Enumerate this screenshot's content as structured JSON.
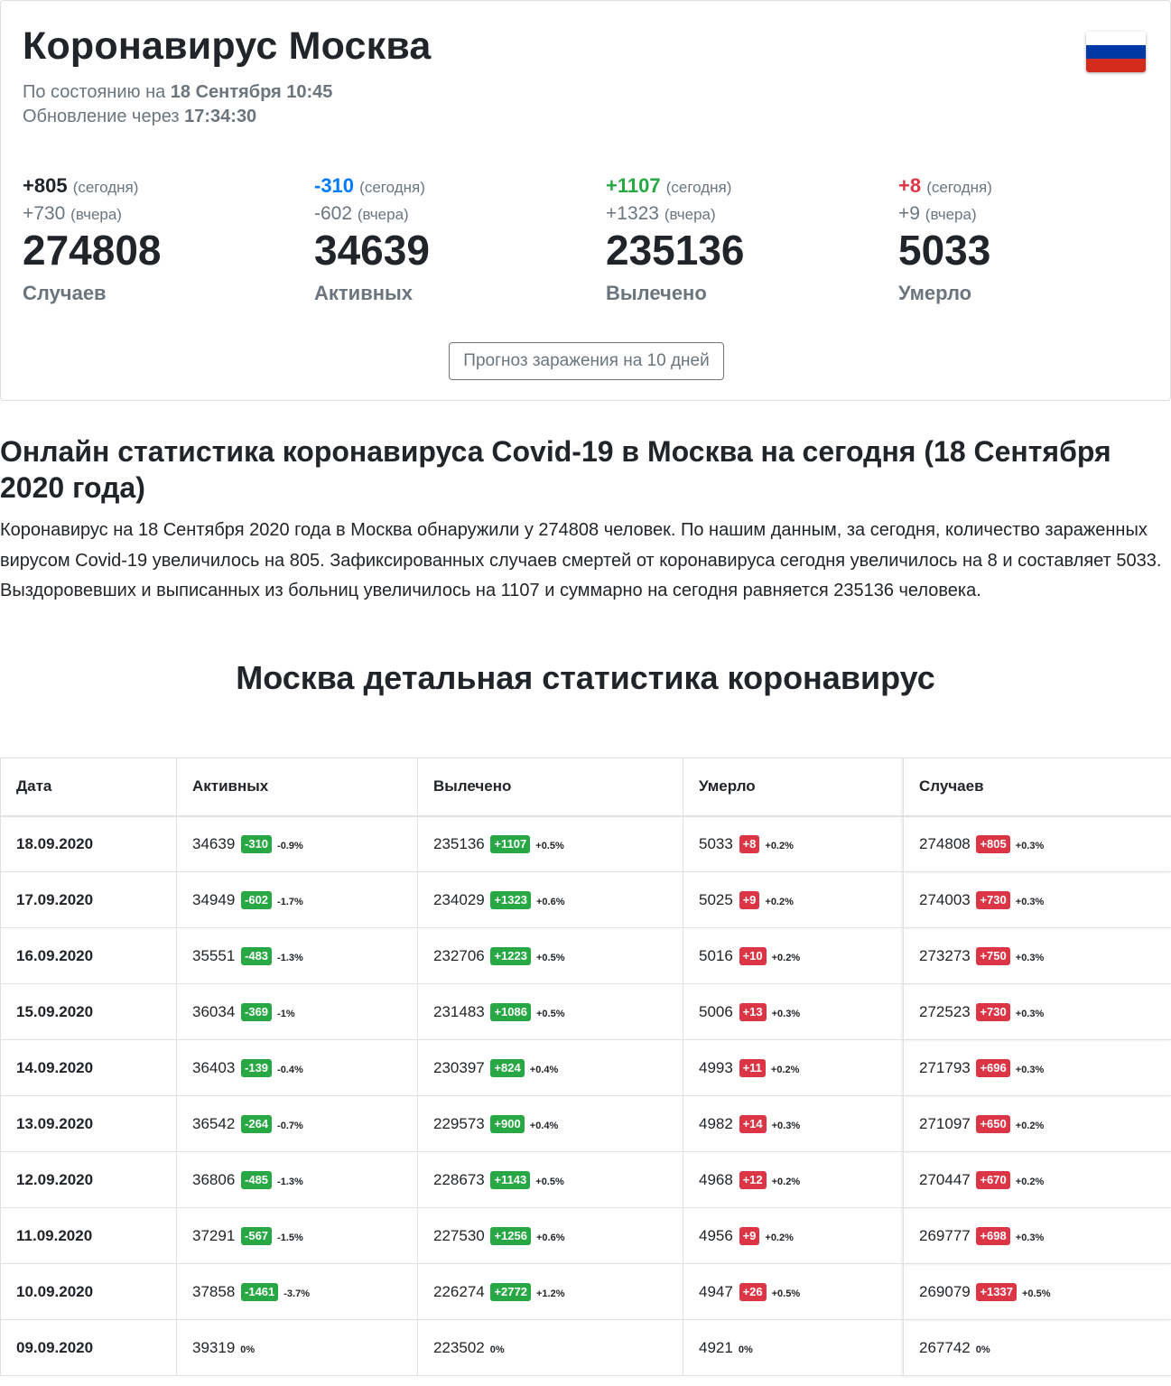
{
  "header": {
    "title": "Коронавирус Москва",
    "status_prefix": "По состоянию на",
    "status_date": "18 Сентября 10:45",
    "update_prefix": "Обновление через",
    "update_time": "17:34:30",
    "flag_icon": "russia-flag-icon",
    "flag_colors": [
      "#ffffff",
      "#0039a6",
      "#d52b1e"
    ]
  },
  "stats": [
    {
      "today": "+805",
      "today_label": "(сегодня)",
      "yesterday": "+730",
      "yesterday_label": "(вчера)",
      "total": "274808",
      "label": "Случаев",
      "today_color": "#212529"
    },
    {
      "today": "-310",
      "today_label": "(сегодня)",
      "yesterday": "-602",
      "yesterday_label": "(вчера)",
      "total": "34639",
      "label": "Активных",
      "today_color": "#007bff"
    },
    {
      "today": "+1107",
      "today_label": "(сегодня)",
      "yesterday": "+1323",
      "yesterday_label": "(вчера)",
      "total": "235136",
      "label": "Вылечено",
      "today_color": "#28a745"
    },
    {
      "today": "+8",
      "today_label": "(сегодня)",
      "yesterday": "+9",
      "yesterday_label": "(вчера)",
      "total": "5033",
      "label": "Умерло",
      "today_color": "#dc3545"
    }
  ],
  "forecast_button": "Прогноз заражения на 10 дней",
  "article": {
    "heading": "Онлайн статистика коронавируса Covid-19 в Москва на сегодня (18 Сентября 2020 года)",
    "text": "Коронавирус на 18 Сентября 2020 года в Москва обнаружили у 274808 человек. По нашим данным, за сегодня, количество зараженных вирусом Covid-19 увеличилось на 805. Зафиксированных случаев смертей от коронавируса сегодня увеличилось на 8 и составляет 5033. Выздоровевших и выписанных из больниц увеличилось на 1107 и суммарно на сегодня равняется 235136 человека."
  },
  "table_title": "Москва детальная статистика коронавирус",
  "table": {
    "headers": [
      "Дата",
      "Активных",
      "Вылечено",
      "Умерло",
      "Случаев"
    ],
    "rows": [
      {
        "date": "18.09.2020",
        "active": "34639",
        "active_d": "-310",
        "active_p": "-0.9%",
        "recov": "235136",
        "recov_d": "+1107",
        "recov_p": "+0.5%",
        "dead": "5033",
        "dead_d": "+8",
        "dead_p": "+0.2%",
        "cases": "274808",
        "cases_d": "+805",
        "cases_p": "+0.3%"
      },
      {
        "date": "17.09.2020",
        "active": "34949",
        "active_d": "-602",
        "active_p": "-1.7%",
        "recov": "234029",
        "recov_d": "+1323",
        "recov_p": "+0.6%",
        "dead": "5025",
        "dead_d": "+9",
        "dead_p": "+0.2%",
        "cases": "274003",
        "cases_d": "+730",
        "cases_p": "+0.3%"
      },
      {
        "date": "16.09.2020",
        "active": "35551",
        "active_d": "-483",
        "active_p": "-1.3%",
        "recov": "232706",
        "recov_d": "+1223",
        "recov_p": "+0.5%",
        "dead": "5016",
        "dead_d": "+10",
        "dead_p": "+0.2%",
        "cases": "273273",
        "cases_d": "+750",
        "cases_p": "+0.3%"
      },
      {
        "date": "15.09.2020",
        "active": "36034",
        "active_d": "-369",
        "active_p": "-1%",
        "recov": "231483",
        "recov_d": "+1086",
        "recov_p": "+0.5%",
        "dead": "5006",
        "dead_d": "+13",
        "dead_p": "+0.3%",
        "cases": "272523",
        "cases_d": "+730",
        "cases_p": "+0.3%"
      },
      {
        "date": "14.09.2020",
        "active": "36403",
        "active_d": "-139",
        "active_p": "-0.4%",
        "recov": "230397",
        "recov_d": "+824",
        "recov_p": "+0.4%",
        "dead": "4993",
        "dead_d": "+11",
        "dead_p": "+0.2%",
        "cases": "271793",
        "cases_d": "+696",
        "cases_p": "+0.3%"
      },
      {
        "date": "13.09.2020",
        "active": "36542",
        "active_d": "-264",
        "active_p": "-0.7%",
        "recov": "229573",
        "recov_d": "+900",
        "recov_p": "+0.4%",
        "dead": "4982",
        "dead_d": "+14",
        "dead_p": "+0.3%",
        "cases": "271097",
        "cases_d": "+650",
        "cases_p": "+0.2%"
      },
      {
        "date": "12.09.2020",
        "active": "36806",
        "active_d": "-485",
        "active_p": "-1.3%",
        "recov": "228673",
        "recov_d": "+1143",
        "recov_p": "+0.5%",
        "dead": "4968",
        "dead_d": "+12",
        "dead_p": "+0.2%",
        "cases": "270447",
        "cases_d": "+670",
        "cases_p": "+0.2%"
      },
      {
        "date": "11.09.2020",
        "active": "37291",
        "active_d": "-567",
        "active_p": "-1.5%",
        "recov": "227530",
        "recov_d": "+1256",
        "recov_p": "+0.6%",
        "dead": "4956",
        "dead_d": "+9",
        "dead_p": "+0.2%",
        "cases": "269777",
        "cases_d": "+698",
        "cases_p": "+0.3%"
      },
      {
        "date": "10.09.2020",
        "active": "37858",
        "active_d": "-1461",
        "active_p": "-3.7%",
        "recov": "226274",
        "recov_d": "+2772",
        "recov_p": "+1.2%",
        "dead": "4947",
        "dead_d": "+26",
        "dead_p": "+0.5%",
        "cases": "269079",
        "cases_d": "+1337",
        "cases_p": "+0.5%"
      },
      {
        "date": "09.09.2020",
        "active": "39319",
        "active_d": "",
        "active_p": "0%",
        "recov": "223502",
        "recov_d": "",
        "recov_p": "0%",
        "dead": "4921",
        "dead_d": "",
        "dead_p": "0%",
        "cases": "267742",
        "cases_d": "",
        "cases_p": "0%"
      }
    ]
  }
}
